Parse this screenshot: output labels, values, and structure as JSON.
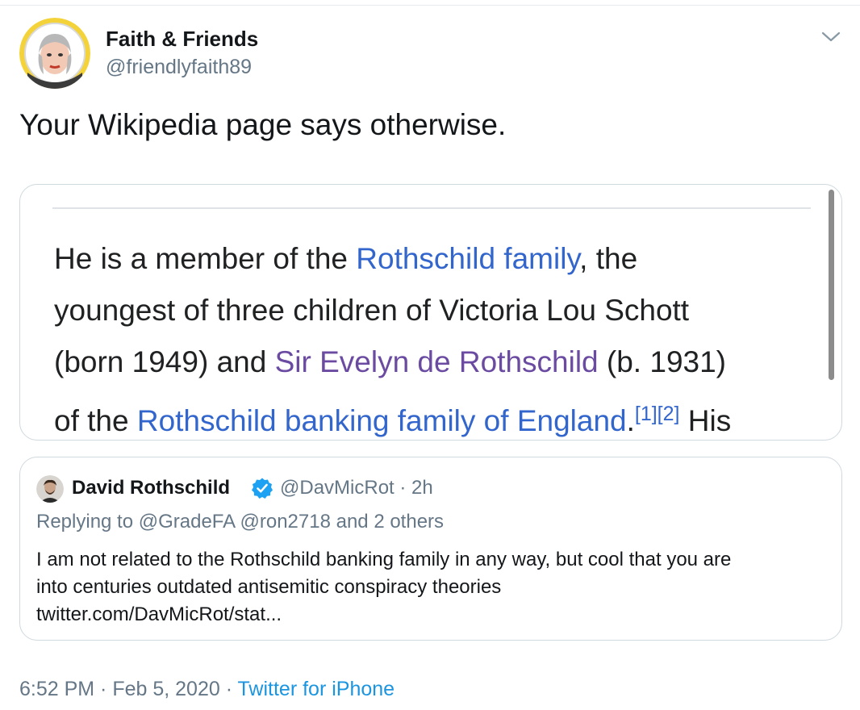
{
  "tweet": {
    "display_name": "Faith & Friends",
    "handle": "@friendlyfaith89",
    "text": "Your Wikipedia page says otherwise.",
    "menu_icon": "chevron-down-icon"
  },
  "media": {
    "lines": [
      {
        "a": "He is a member of the ",
        "link": "Rothschild family",
        "b": ", the"
      },
      {
        "a": "youngest of three children of Victoria Lou Schott"
      },
      {
        "a": "(born 1949) and ",
        "visited": "Sir Evelyn de Rothschild",
        "b": " (b. 1931)"
      },
      {
        "a": "of the ",
        "link": "Rothschild banking family of England",
        "b": ".",
        "sup": "[1][2]",
        "c": " His"
      }
    ]
  },
  "quote": {
    "name": "David Rothschild",
    "verified_icon": "verified-badge-icon",
    "handle_time": "@DavMicRot · 2h",
    "replying": "Replying to @GradeFA @ron2718 and 2 others",
    "body_lines": [
      "I am not related to the Rothschild banking family in any way, but cool that you are",
      "into centuries outdated antisemitic conspiracy theories",
      "twitter.com/DavMicRot/stat..."
    ]
  },
  "footer": {
    "time_date": "6:52 PM · Feb 5, 2020 · ",
    "source": "Twitter for iPhone"
  },
  "colors": {
    "link": "#3366cc",
    "visited_link": "#6b4ba1",
    "secondary_text": "#657786",
    "twitter_blue": "#1b95e0"
  }
}
